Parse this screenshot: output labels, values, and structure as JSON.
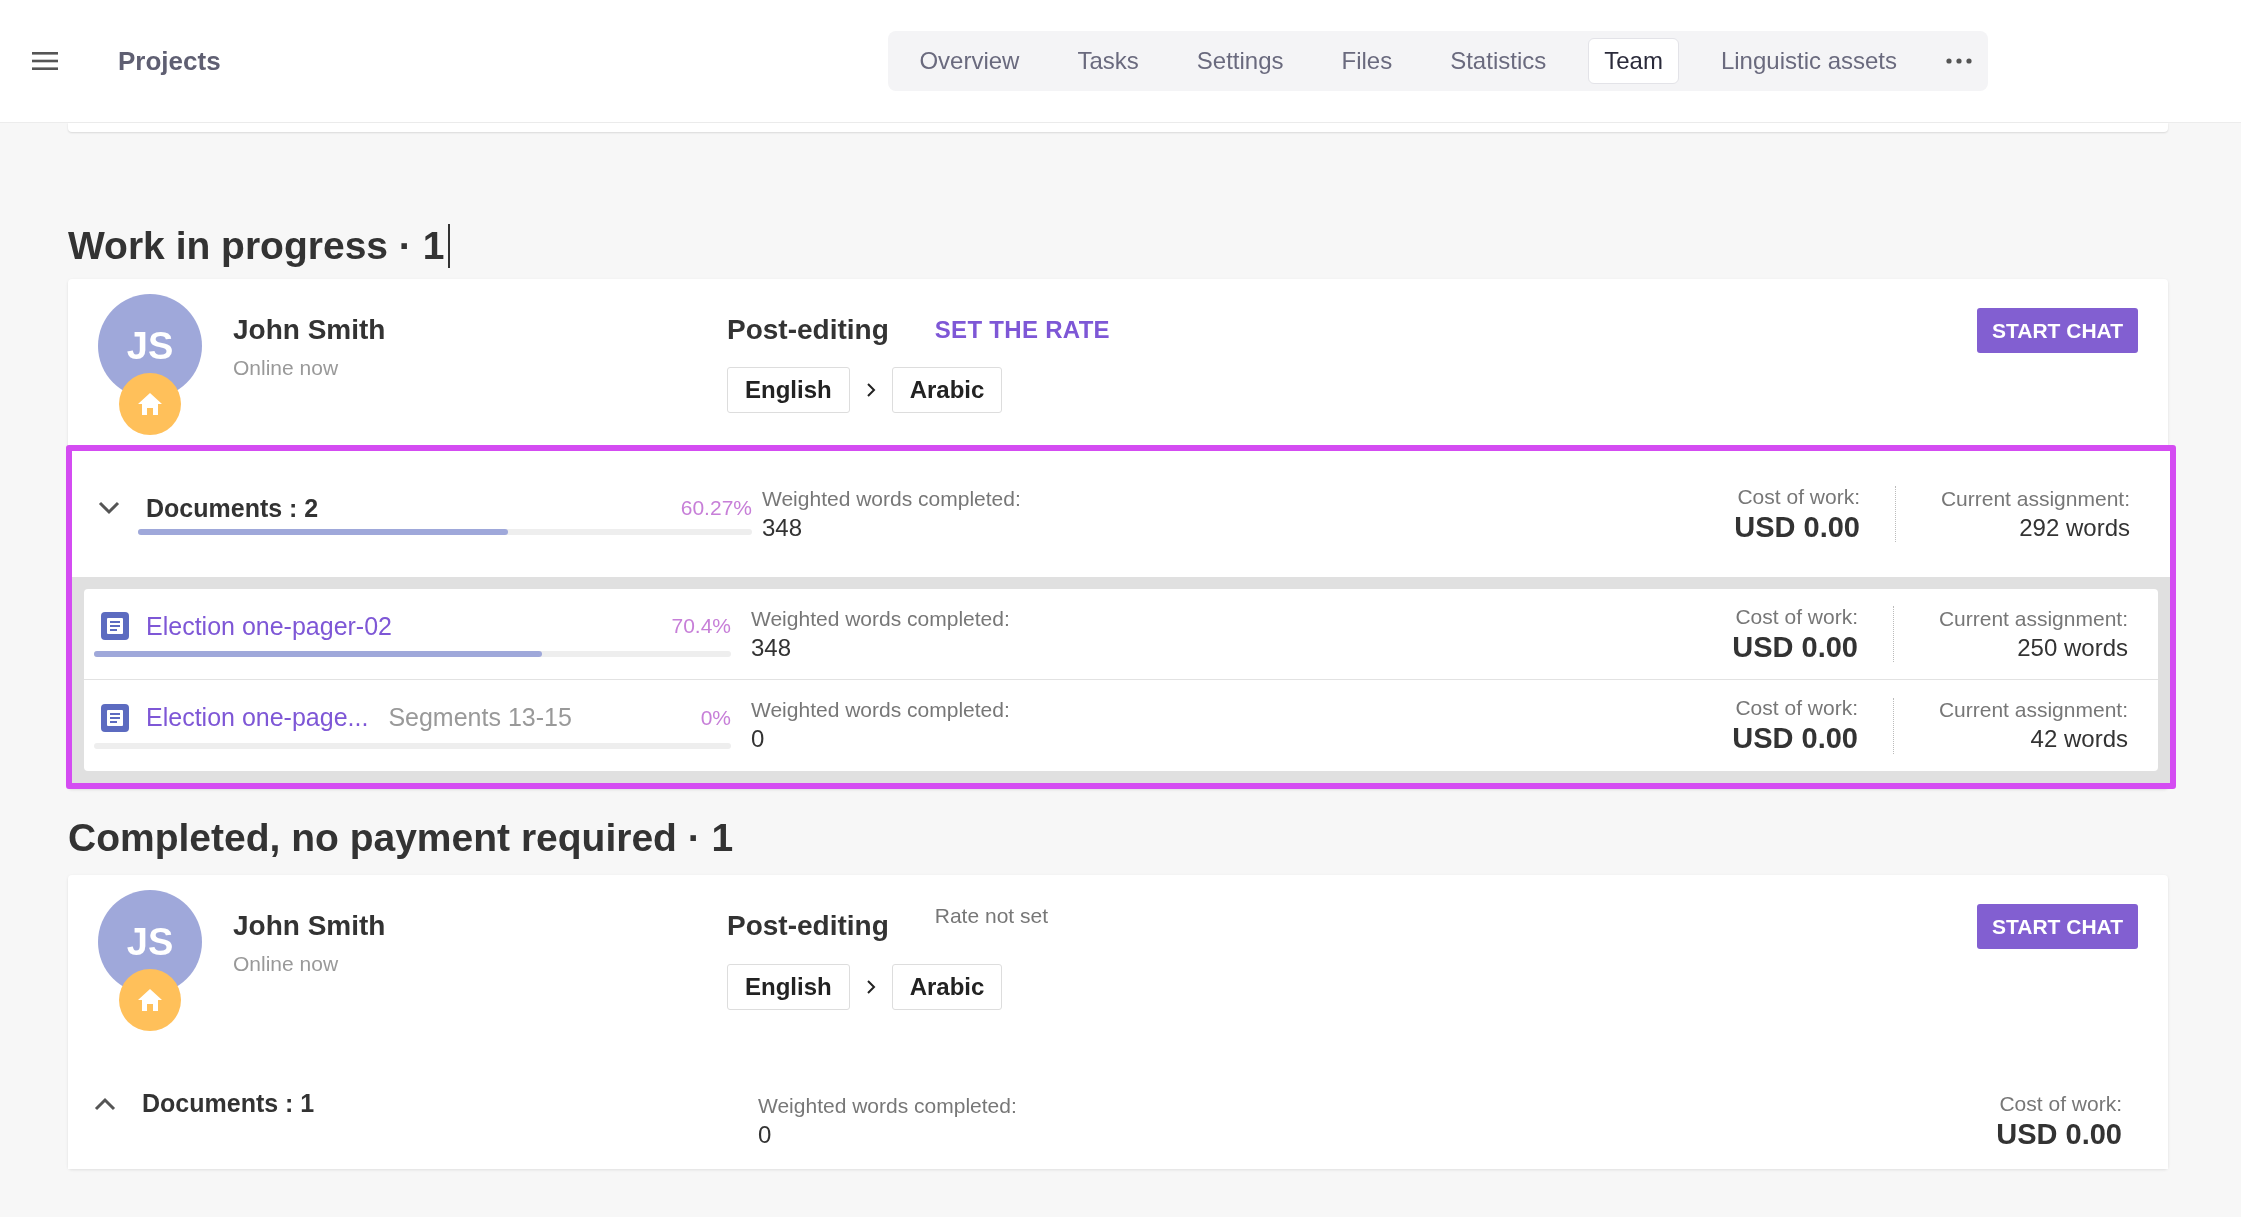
{
  "header": {
    "title": "Projects",
    "tabs": [
      {
        "label": "Overview",
        "selected": false
      },
      {
        "label": "Tasks",
        "selected": false
      },
      {
        "label": "Settings",
        "selected": false
      },
      {
        "label": "Files",
        "selected": false
      },
      {
        "label": "Statistics",
        "selected": false
      },
      {
        "label": "Team",
        "selected": true
      },
      {
        "label": "Linguistic assets",
        "selected": false
      }
    ]
  },
  "sections": [
    {
      "heading": "Work in progress · 1",
      "focused": true,
      "cards": [
        {
          "initials": "JS",
          "name": "John Smith",
          "status": "Online now",
          "service": "Post-editing",
          "rate": {
            "kind": "link",
            "text": "SET THE RATE"
          },
          "source": "English",
          "target": "Arabic",
          "button": "START CHAT",
          "documents": {
            "label": "Documents : 2",
            "expanded": true,
            "highlighted": true,
            "percent": "60.27%",
            "level": 0.6027,
            "weighted_label": "Weighted words completed:",
            "weighted": "348",
            "cost_label": "Cost of work:",
            "cost": "USD 0.00",
            "assignment_label": "Current assignment:",
            "assignment": "292 words",
            "items": [
              {
                "title": "Election one-pager-02",
                "percent": "70.4%",
                "level": 0.704,
                "weighted_label": "Weighted words completed:",
                "weighted": "348",
                "cost_label": "Cost of work:",
                "cost": "USD 0.00",
                "assignment_label": "Current assignment:",
                "assignment": "250 words"
              },
              {
                "title": "Election one-page...",
                "segments": "Segments 13-15",
                "percent": "0%",
                "level": 0,
                "weighted_label": "Weighted words completed:",
                "weighted": "0",
                "cost_label": "Cost of work:",
                "cost": "USD 0.00",
                "assignment_label": "Current assignment:",
                "assignment": "42 words"
              }
            ]
          }
        }
      ]
    },
    {
      "heading": "Completed, no payment required · 1",
      "focused": false,
      "cards": [
        {
          "initials": "JS",
          "name": "John Smith",
          "status": "Online now",
          "service": "Post-editing",
          "rate": {
            "kind": "note",
            "text": "Rate not set"
          },
          "source": "English",
          "target": "Arabic",
          "button": "START CHAT",
          "documents": {
            "label": "Documents : 1",
            "expanded": false,
            "highlighted": false,
            "weighted_label": "Weighted words completed:",
            "weighted": "0",
            "cost_label": "Cost of work:",
            "cost": "USD 0.00"
          }
        }
      ]
    }
  ]
}
